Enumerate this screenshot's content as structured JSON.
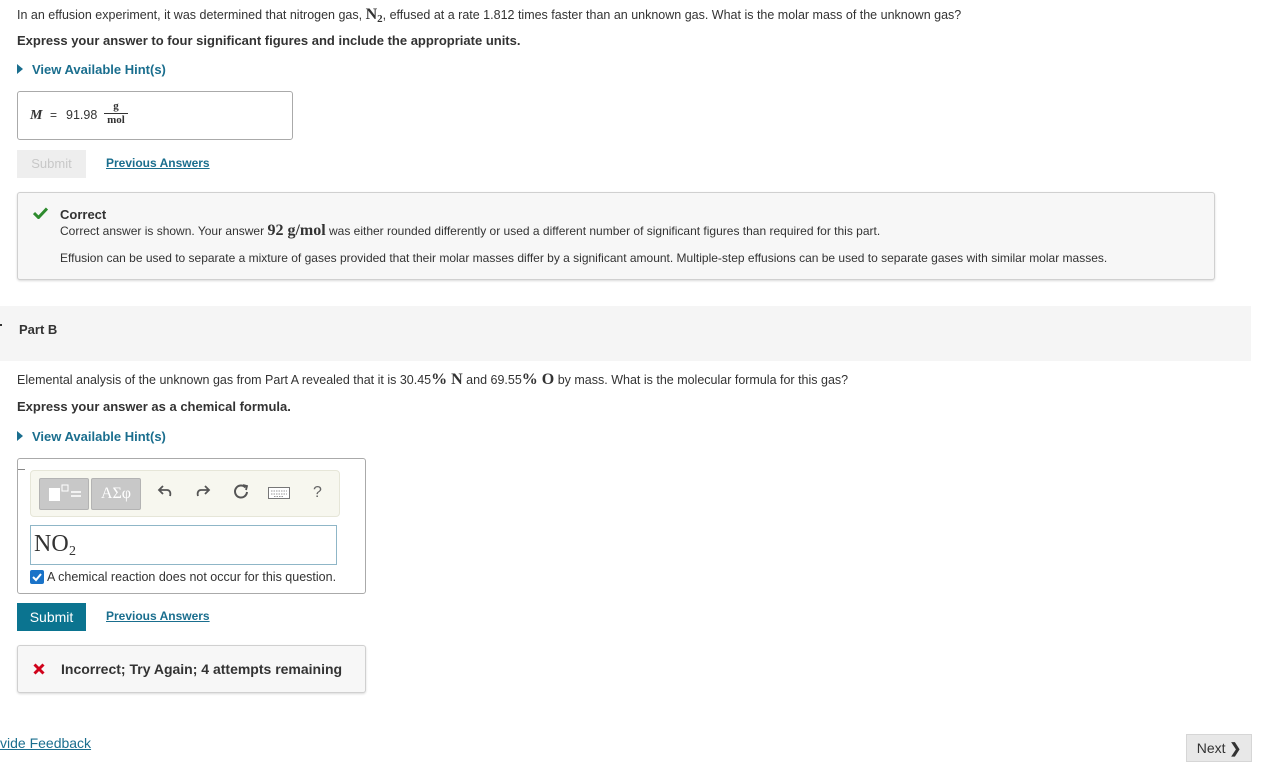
{
  "partA": {
    "question_prefix": "In an effusion experiment, it was determined that nitrogen gas, ",
    "question_n": "N",
    "question_sub": "2",
    "question_suffix": ", effused at a rate 1.812 times faster than an unknown gas.  What is the molar mass of the unknown gas?",
    "instruction": "Express your answer to four significant figures and include the appropriate units.",
    "hint_label": "View Available Hint(s)",
    "answer_var": "M",
    "answer_eq": "=",
    "answer_value": "91.98",
    "unit_num": "g",
    "unit_den": "mol",
    "submit_label": "Submit",
    "previous_answers_label": "Previous Answers",
    "feedback_title": "Correct",
    "feedback_line1_prefix": "Correct answer is shown. Your answer ",
    "feedback_line1_value": "92 g/mol",
    "feedback_line1_suffix": " was either rounded differently or used a different number of significant figures than required for this part.",
    "feedback_line2": "Effusion can be used to separate a mixture of gases provided that their molar masses differ by a significant amount. Multiple-step effusions can be used to separate gases with similar molar masses."
  },
  "partB": {
    "title": "Part B",
    "question_prefix": "Elemental analysis of the unknown gas from Part A revealed that it is 30.45",
    "question_pct1": "% N",
    "question_mid": " and 69.55",
    "question_pct2": "% O",
    "question_suffix": " by mass. What is the molecular formula for this gas?",
    "instruction": "Express your answer as a chemical formula.",
    "hint_label": "View Available Hint(s)",
    "toolbar_greek": "ΑΣφ",
    "toolbar_help": "?",
    "formula_main": "NO",
    "formula_sub": "2",
    "checkbox_label": "A chemical reaction does not occur for this question.",
    "checkbox_checked": true,
    "submit_label": "Submit",
    "previous_answers_label": "Previous Answers",
    "feedback_text": "Incorrect; Try Again; 4 attempts remaining"
  },
  "footer": {
    "feedback_link": "vide Feedback",
    "next_label": "Next"
  },
  "colors": {
    "accent": "#0b7490",
    "link": "#1a6e8e",
    "correct": "#2e8b2e",
    "incorrect": "#d0021b"
  }
}
